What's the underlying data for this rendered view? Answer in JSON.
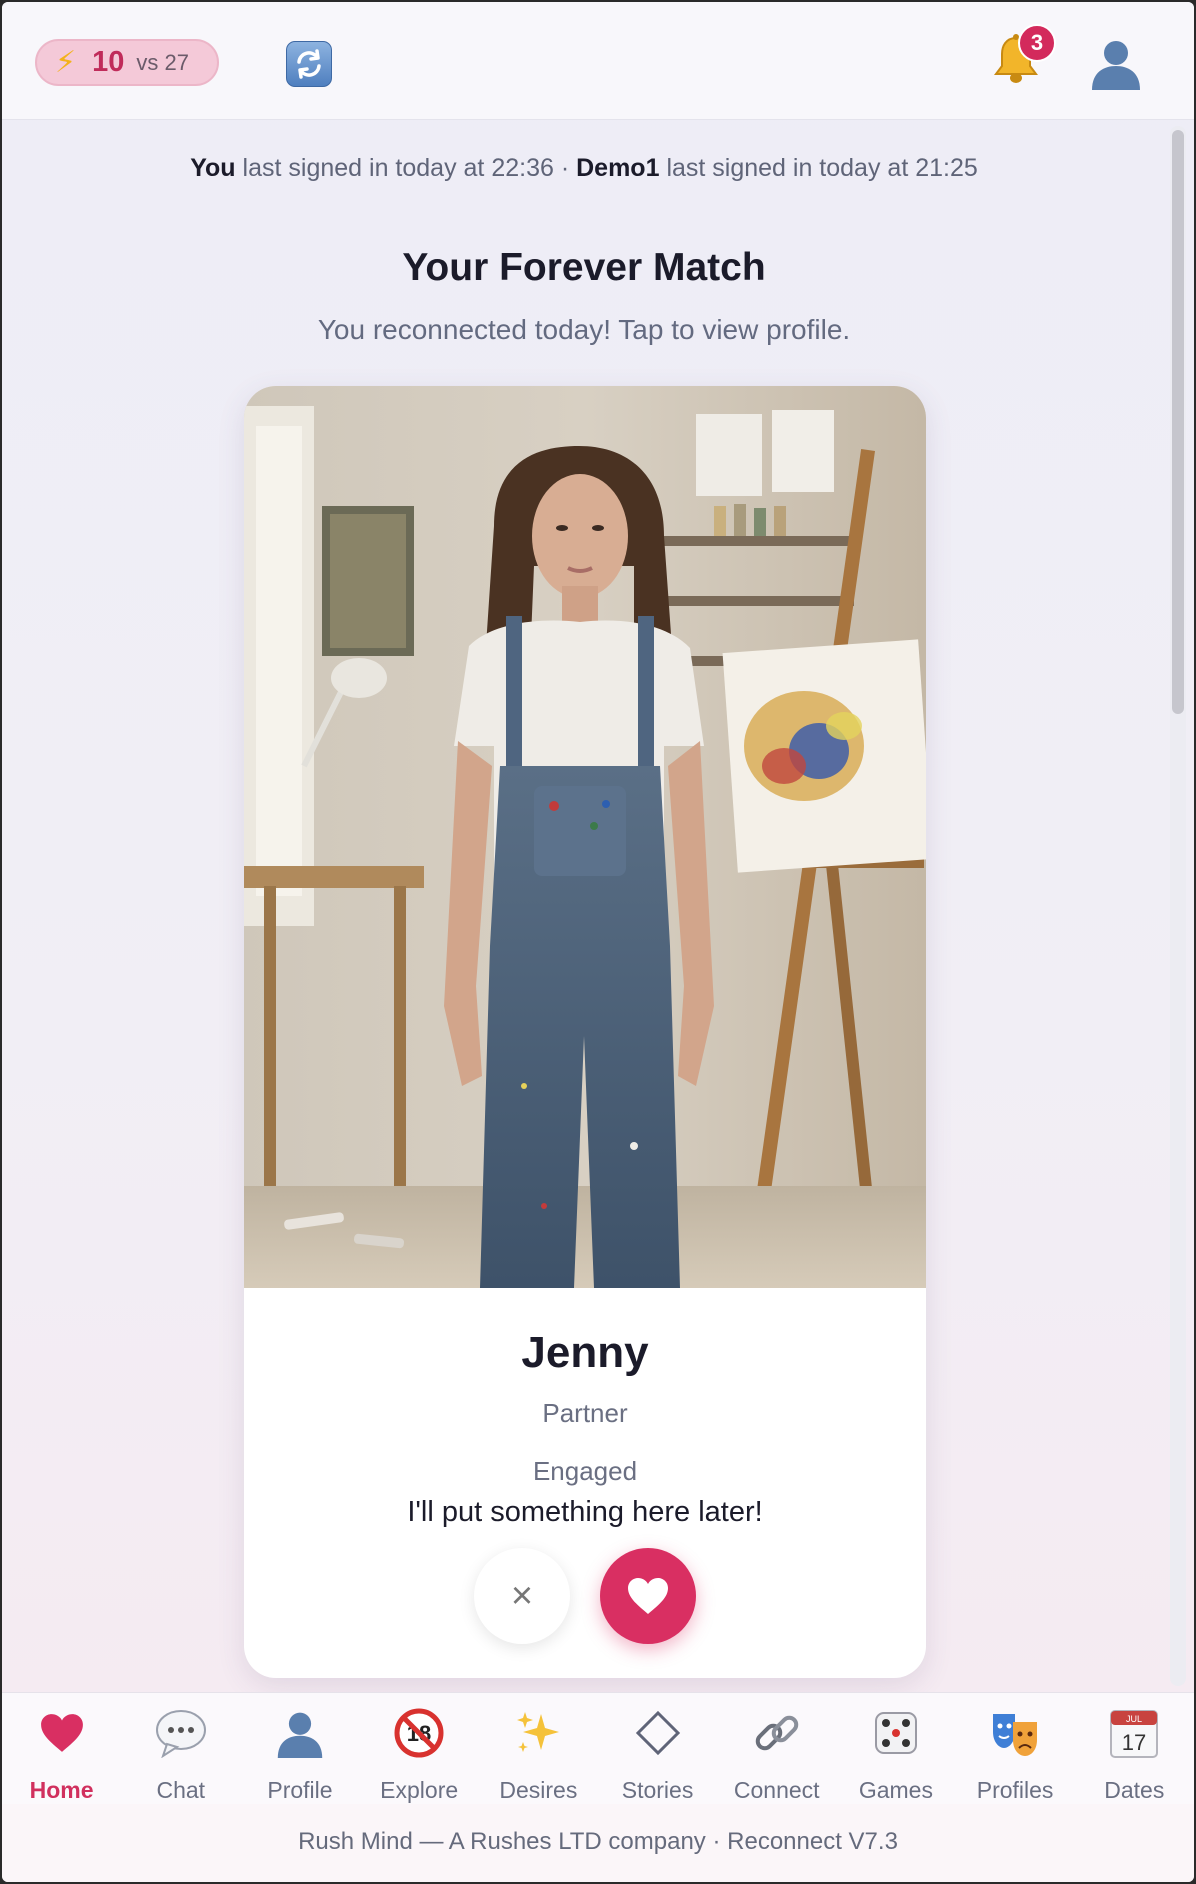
{
  "header": {
    "score": "10",
    "vs": "vs 27",
    "notifications_count": "3"
  },
  "signin": {
    "you": "You",
    "you_text": "last signed in today at 22:36",
    "separator": "·",
    "partner": "Demo1",
    "partner_text": "last signed in today at 21:25"
  },
  "main": {
    "title": "Your Forever Match",
    "subtitle": "You reconnected today! Tap to view profile."
  },
  "card": {
    "name": "Jenny",
    "role": "Partner",
    "status": "Engaged",
    "bio": "I'll put something here later!",
    "dismiss_label": "×"
  },
  "nav": {
    "items": [
      {
        "label": "Home",
        "icon": "heart-icon"
      },
      {
        "label": "Chat",
        "icon": "speech-bubble-icon"
      },
      {
        "label": "Profile",
        "icon": "user-icon"
      },
      {
        "label": "Explore",
        "icon": "no-under-18-icon"
      },
      {
        "label": "Desires",
        "icon": "sparkles-icon"
      },
      {
        "label": "Stories",
        "icon": "diamond-icon"
      },
      {
        "label": "Connect",
        "icon": "link-icon"
      },
      {
        "label": "Games",
        "icon": "dice-icon"
      },
      {
        "label": "Profiles",
        "icon": "theater-masks-icon"
      },
      {
        "label": "Dates",
        "icon": "calendar-icon"
      }
    ],
    "calendar_month": "JUL",
    "calendar_day": "17"
  },
  "footer": {
    "text": "Rush Mind — A Rushes LTD company · Reconnect V7.3"
  },
  "colors": {
    "accent": "#d92f62",
    "pill_bg": "#f4c9d8",
    "text_muted": "#636a80"
  }
}
